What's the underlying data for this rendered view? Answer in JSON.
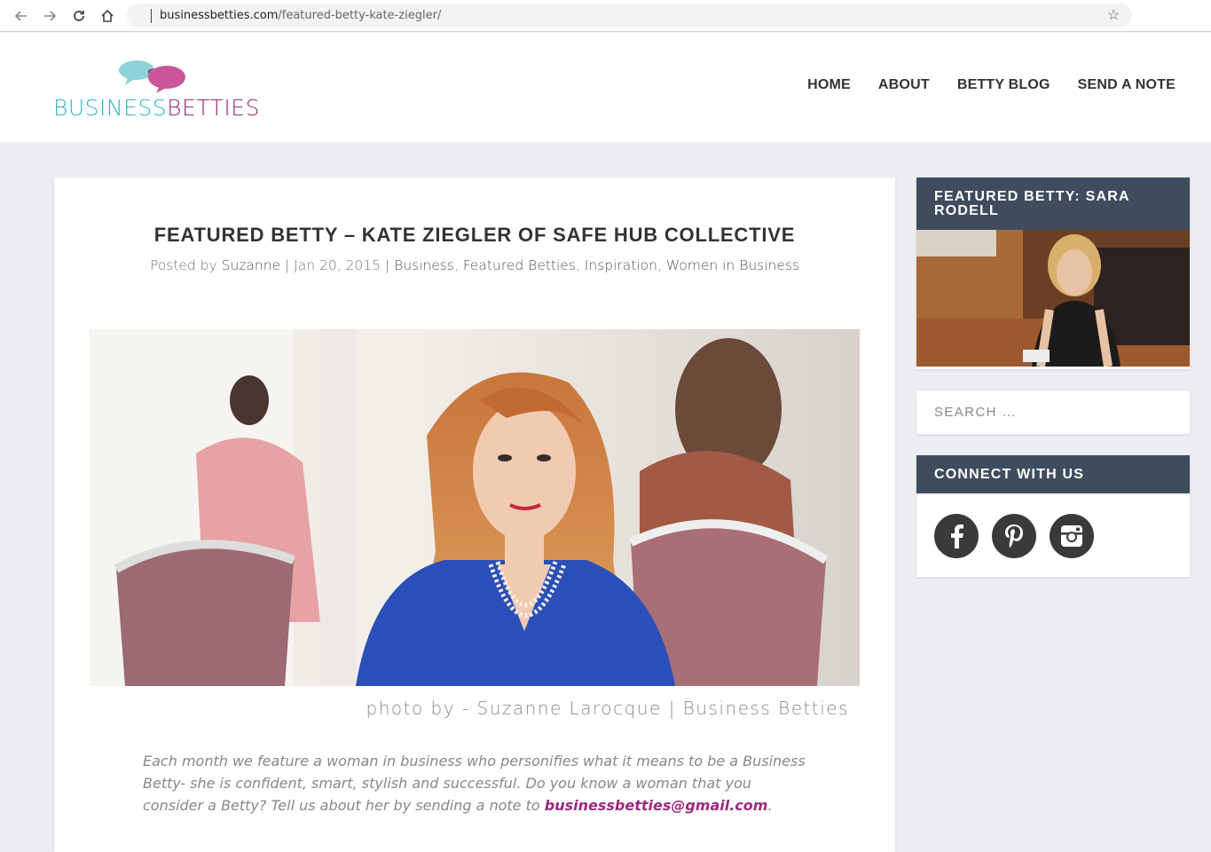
{
  "browser": {
    "url_domain": "businessbetties.com",
    "url_path": "/featured-betty-kate-ziegler/"
  },
  "header": {
    "logo_part1": "BUSINESS",
    "logo_part2": "BETTIES",
    "nav": [
      "HOME",
      "ABOUT",
      "BETTY BLOG",
      "SEND A NOTE"
    ]
  },
  "article": {
    "title": "FEATURED BETTY – KATE ZIEGLER OF SAFE HUB COLLECTIVE",
    "meta": {
      "prefix": "Posted by ",
      "author": "Suzanne",
      "sep1": " | ",
      "date": "Jan 20, 2015",
      "sep2": " | ",
      "categories": [
        "Business",
        "Featured Betties",
        "Inspiration",
        "Women in Business"
      ]
    },
    "photo_caption": "photo by - Suzanne Larocque | Business Betties",
    "intro": "Each month we feature a woman in business who personifies what it means to be a Business Betty- she is confident, smart, stylish and successful. Do you know a woman that you consider a Betty? Tell us about her by sending a note to ",
    "intro_email": "businessbetties@gmail.com",
    "intro_end": "."
  },
  "sidebar": {
    "featured_title": "FEATURED BETTY: SARA RODELL",
    "search_placeholder": "SEARCH …",
    "connect_title": "CONNECT WITH US",
    "social_icons": [
      "facebook-icon",
      "pinterest-icon",
      "instagram-icon"
    ]
  },
  "colors": {
    "accent_teal": "#2bb8c5",
    "accent_plum": "#9b2a7d",
    "widget_header": "#3e4c5e",
    "page_bg": "#eceef1"
  }
}
